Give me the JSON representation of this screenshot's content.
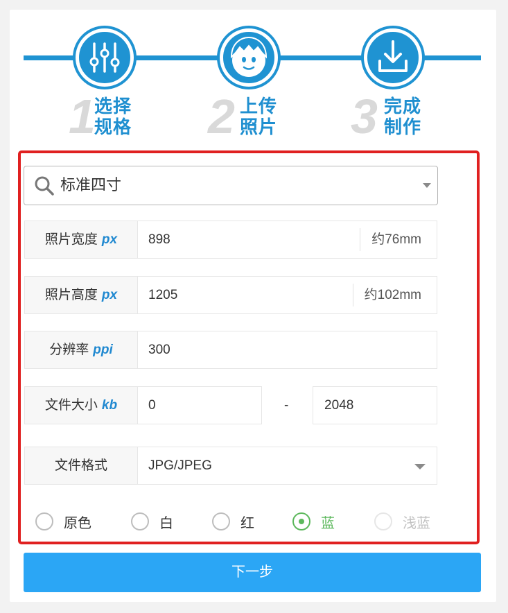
{
  "steps": [
    {
      "num": "1",
      "line1": "选择",
      "line2": "规格",
      "icon": "sliders-icon"
    },
    {
      "num": "2",
      "line1": "上传",
      "line2": "照片",
      "icon": "face-icon"
    },
    {
      "num": "3",
      "line1": "完成",
      "line2": "制作",
      "icon": "download-icon"
    }
  ],
  "spec_search": {
    "value": "标准四寸",
    "icon": "search-icon"
  },
  "fields": {
    "width": {
      "label": "照片宽度",
      "unit": "px",
      "value": "898",
      "suffix": "约76mm"
    },
    "height": {
      "label": "照片高度",
      "unit": "px",
      "value": "1205",
      "suffix": "约102mm"
    },
    "resolution": {
      "label": "分辨率",
      "unit": "ppi",
      "value": "300"
    },
    "file_size": {
      "label": "文件大小",
      "unit": "kb",
      "min": "0",
      "separator": "-",
      "max": "2048"
    },
    "format": {
      "label": "文件格式",
      "value": "JPG/JPEG"
    }
  },
  "background_colors": [
    {
      "label": "原色",
      "state": "unchecked"
    },
    {
      "label": "白",
      "state": "unchecked"
    },
    {
      "label": "红",
      "state": "unchecked"
    },
    {
      "label": "蓝",
      "state": "checked"
    },
    {
      "label": "浅蓝",
      "state": "disabled"
    }
  ],
  "accent_colors": {
    "primary": "#1f93d2",
    "button": "#2ba6f5",
    "selected": "#5cb85c",
    "highlight_border": "#e02020"
  },
  "next_button": {
    "label": "下一步"
  }
}
